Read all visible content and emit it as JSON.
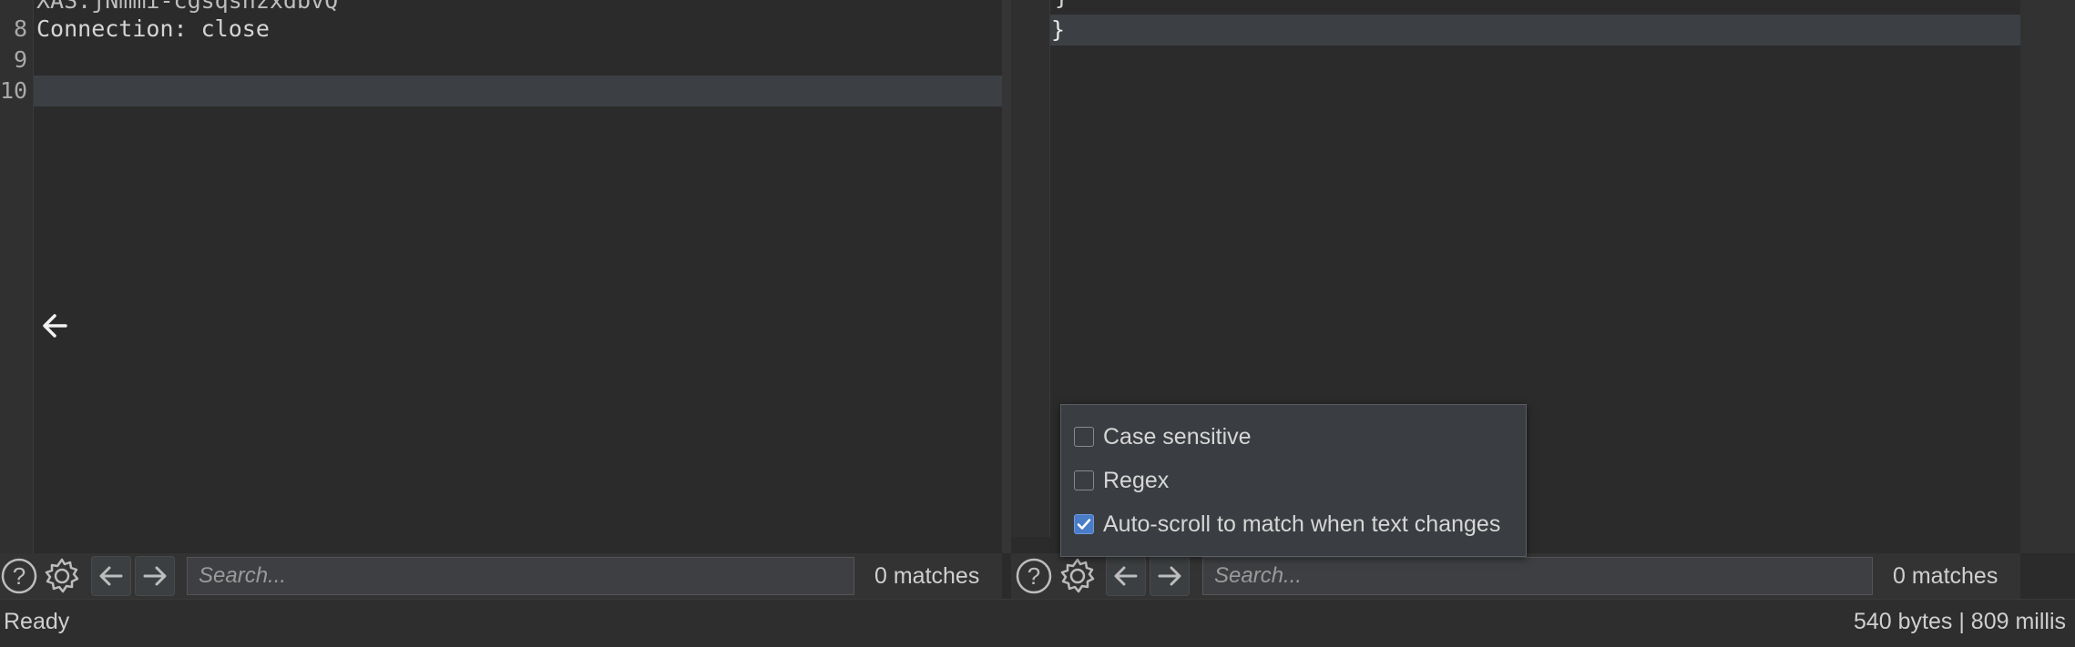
{
  "request_editor": {
    "partial_top_line": "XAS:jNmmi-cgsqshzxdbvQ",
    "lines": [
      {
        "num": "8",
        "text": "Connection: close"
      },
      {
        "num": "9",
        "text": ""
      },
      {
        "num": "10",
        "text": ""
      }
    ]
  },
  "response_editor": {
    "partial_top_line": "}",
    "closing_line": "}"
  },
  "left_toolbar": {
    "search_placeholder": "Search...",
    "matches": "0 matches"
  },
  "right_toolbar": {
    "search_placeholder": "Search...",
    "matches": "0 matches"
  },
  "search_options": [
    {
      "label": "Case sensitive",
      "checked": false
    },
    {
      "label": "Regex",
      "checked": false
    },
    {
      "label": "Auto-scroll to match when text changes",
      "checked": true
    }
  ],
  "status": {
    "left": "Ready",
    "right": "540 bytes | 809 millis"
  },
  "colors": {
    "background": "#2b2b2b",
    "highlight_line": "#3c3f43",
    "checkbox_accent": "#4b7cc7"
  }
}
